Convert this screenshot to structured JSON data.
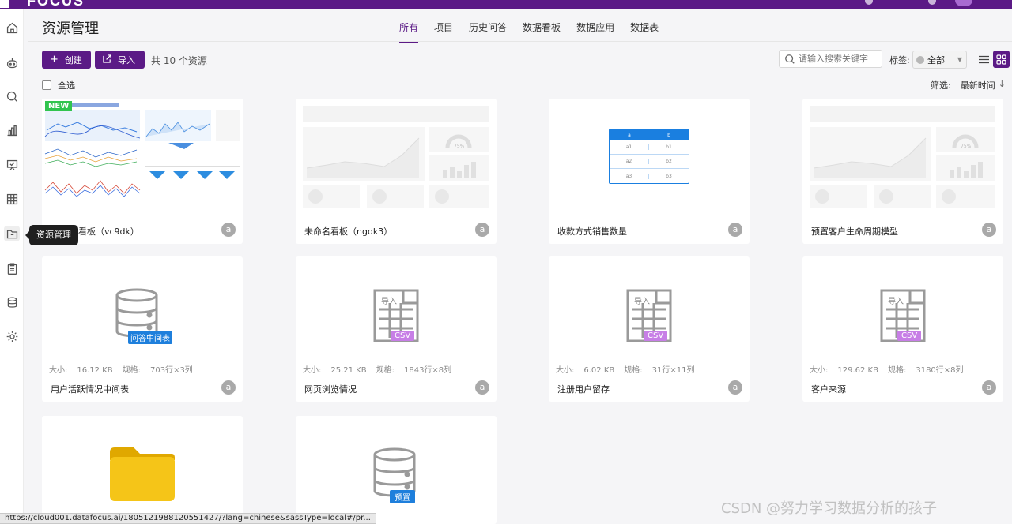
{
  "brand": "FOCUS",
  "page_title": "资源管理",
  "tabs": [
    {
      "label": "所有",
      "active": true
    },
    {
      "label": "项目"
    },
    {
      "label": "历史问答"
    },
    {
      "label": "数据看板"
    },
    {
      "label": "数据应用"
    },
    {
      "label": "数据表"
    }
  ],
  "toolbar": {
    "create_label": "创建",
    "import_label": "导入",
    "count_text": "共 10 个资源",
    "search_placeholder": "请输入搜索关键字",
    "tag_label": "标签:",
    "tag_value": "全部"
  },
  "select_all_label": "全选",
  "sort": {
    "filter_label": "筛选:",
    "value": "最新时间"
  },
  "tooltip": "资源管理",
  "sidebar_icons": [
    "home-icon",
    "robot-icon",
    "search-icon",
    "chart-icon",
    "presentation-icon",
    "grid-table-icon",
    "folder-icon",
    "clipboard-icon",
    "database-icon",
    "gear-icon"
  ],
  "cards": [
    {
      "name": "看板（vc9dk）",
      "type": "dashboard-real",
      "owner": "a",
      "badge": "NEW"
    },
    {
      "name": "未命名看板（ngdk3）",
      "type": "dashboard-skeleton",
      "owner": "a"
    },
    {
      "name": "收款方式销售数量",
      "type": "table-widget",
      "owner": "a"
    },
    {
      "name": "预置客户生命周期模型",
      "type": "dashboard-skeleton",
      "owner": "a"
    },
    {
      "name": "用户活跃情况中间表",
      "type": "db",
      "db_badge": "问答中间表",
      "owner": "a",
      "size_label": "大小:",
      "size": "16.12 KB",
      "spec_label": "规格:",
      "spec": "703行×3列"
    },
    {
      "name": "网页浏览情况",
      "type": "csv",
      "import_text": "导入",
      "csv_badge": "CSV",
      "owner": "a",
      "size_label": "大小:",
      "size": "25.21 KB",
      "spec_label": "规格:",
      "spec": "1843行×8列"
    },
    {
      "name": "注册用户留存",
      "type": "csv",
      "import_text": "导入",
      "csv_badge": "CSV",
      "owner": "a",
      "size_label": "大小:",
      "size": "6.02 KB",
      "spec_label": "规格:",
      "spec": "31行×11列"
    },
    {
      "name": "客户来源",
      "type": "csv",
      "import_text": "导入",
      "csv_badge": "CSV",
      "owner": "a",
      "size_label": "大小:",
      "size": "129.62 KB",
      "spec_label": "规格:",
      "spec": "3180行×8列"
    },
    {
      "name": "",
      "type": "folder"
    },
    {
      "name": "",
      "type": "db",
      "db_badge": "预置"
    }
  ],
  "table_widget": {
    "col_a": "a",
    "col_b": "b",
    "rows": [
      [
        "a1",
        "b1"
      ],
      [
        "a2",
        "b2"
      ],
      [
        "a3",
        "b3"
      ]
    ]
  },
  "gauge_label": "75%",
  "status_url": "https://cloud001.datafocus.ai/1805121988120551427/?lang=chinese&sassType=local#/pr...",
  "watermark": "CSDN @努力学习数据分析的孩子",
  "colors": {
    "brand": "#5b1a86",
    "new_badge": "#31c44f",
    "csv_badge": "#c77ee6",
    "db_badge": "#1e7fdc",
    "folder": "#f5c518"
  }
}
